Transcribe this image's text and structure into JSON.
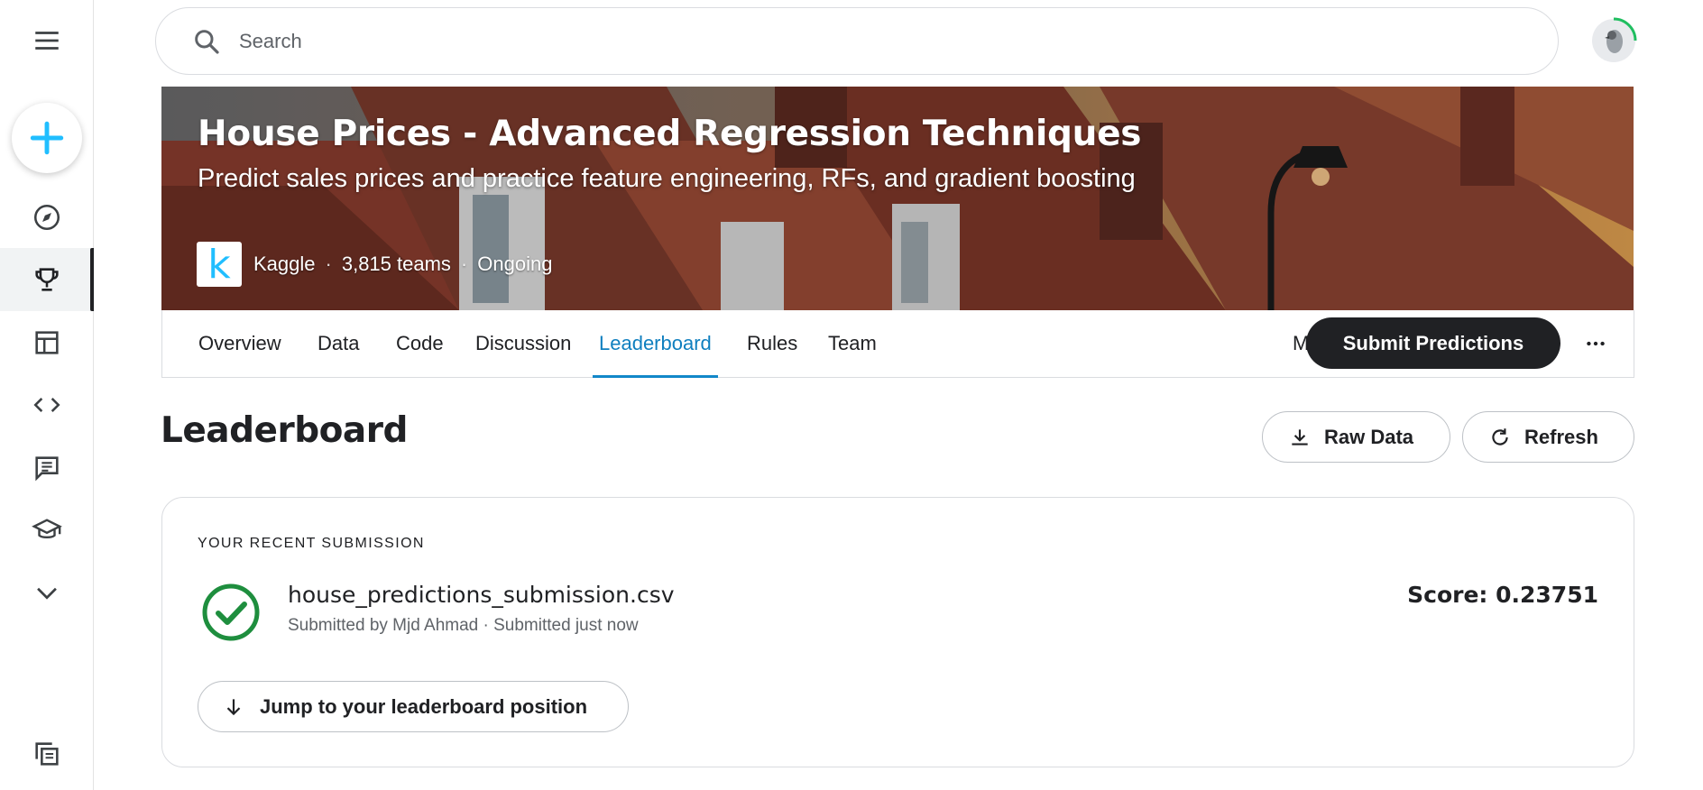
{
  "search": {
    "placeholder": "Search"
  },
  "sidebar": {
    "items": [
      {
        "name": "menu-icon"
      },
      {
        "name": "create-icon"
      },
      {
        "name": "compass-icon"
      },
      {
        "name": "trophy-icon",
        "active": true
      },
      {
        "name": "table-icon"
      },
      {
        "name": "code-icon"
      },
      {
        "name": "comment-icon"
      },
      {
        "name": "school-icon"
      },
      {
        "name": "chevron-down-icon"
      },
      {
        "name": "copy-icon"
      }
    ]
  },
  "competition": {
    "title": "House Prices - Advanced Regression Techniques",
    "subtitle": "Predict sales prices and practice feature engineering, RFs, and gradient boosting",
    "host_logo_letter": "k",
    "host": "Kaggle",
    "teams": "3,815 teams",
    "status": "Ongoing",
    "separator": "·"
  },
  "tabs": [
    {
      "label": "Overview"
    },
    {
      "label": "Data"
    },
    {
      "label": "Code"
    },
    {
      "label": "Discussion"
    },
    {
      "label": "Leaderboard",
      "active": true
    },
    {
      "label": "Rules"
    },
    {
      "label": "Team"
    }
  ],
  "actions": {
    "my_submissions": "My Submissions",
    "submit_predictions": "Submit Predictions"
  },
  "leaderboard": {
    "title": "Leaderboard",
    "raw_data": "Raw Data",
    "refresh": "Refresh"
  },
  "recent_submission": {
    "label": "YOUR RECENT SUBMISSION",
    "file_name": "house_predictions_submission.csv",
    "meta": "Submitted by Mjd Ahmad · Submitted just now",
    "score": "Score: 0.23751",
    "jump_label": "Jump to your leaderboard position"
  },
  "colors": {
    "accent": "#20beff",
    "active_tab": "#0f7fbf",
    "success": "#1e8e3e",
    "dark_button": "#202124"
  }
}
